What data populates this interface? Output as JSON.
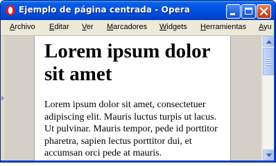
{
  "window": {
    "title": "Ejemplo de página centrada - Opera",
    "app_icon": "opera-icon",
    "controls": [
      "minimize-icon",
      "maximize-icon",
      "close-icon"
    ]
  },
  "menu": {
    "items": [
      {
        "mnemonic": "A",
        "rest": "rchivo"
      },
      {
        "mnemonic": "E",
        "rest": "ditar"
      },
      {
        "mnemonic": "V",
        "rest": "er"
      },
      {
        "mnemonic": "M",
        "rest": "arcadores"
      },
      {
        "mnemonic": "W",
        "rest": "idgets"
      },
      {
        "mnemonic": "H",
        "rest": "erramientas"
      },
      {
        "mnemonic": "A",
        "rest": "yu"
      }
    ]
  },
  "page": {
    "heading": "Lorem ipsum dolor sit amet",
    "paragraph": "Lorem ipsum dolor sit amet, consectetuer adipiscing elit. Mauris luctus turpis ut lacus. Ut pulvinar. Mauris tempor, pede id porttitor pharetra, sapien lectus porttitor dui, et accumsan orci pede at mauris."
  },
  "colors": {
    "titlebar": "#0054e3",
    "page_background": "#ffffff",
    "side_background": "#d4d0c8"
  }
}
